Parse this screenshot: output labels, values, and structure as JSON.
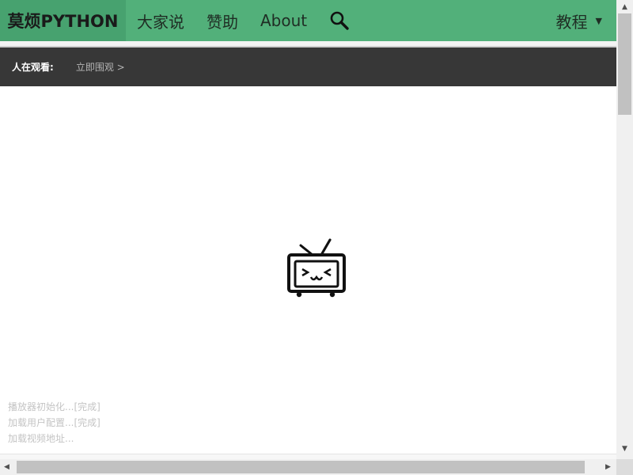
{
  "nav": {
    "brand": "莫烦PYTHON",
    "links": [
      "大家说",
      "赞助",
      "About"
    ],
    "tutorial_label": "教程",
    "caret": "▼"
  },
  "watchbar": {
    "label": "人在观看:",
    "link": "立即围观 >"
  },
  "player": {
    "log": [
      "播放器初始化...[完成]",
      "加载用户配置...[完成]",
      "加载视频地址..."
    ]
  },
  "scroll": {
    "up": "▲",
    "down": "▼",
    "left": "◀",
    "right": "▶"
  },
  "colors": {
    "nav_bg": "#52b07a",
    "brand_bg": "#47a26f",
    "watchbar_bg": "#373737"
  }
}
